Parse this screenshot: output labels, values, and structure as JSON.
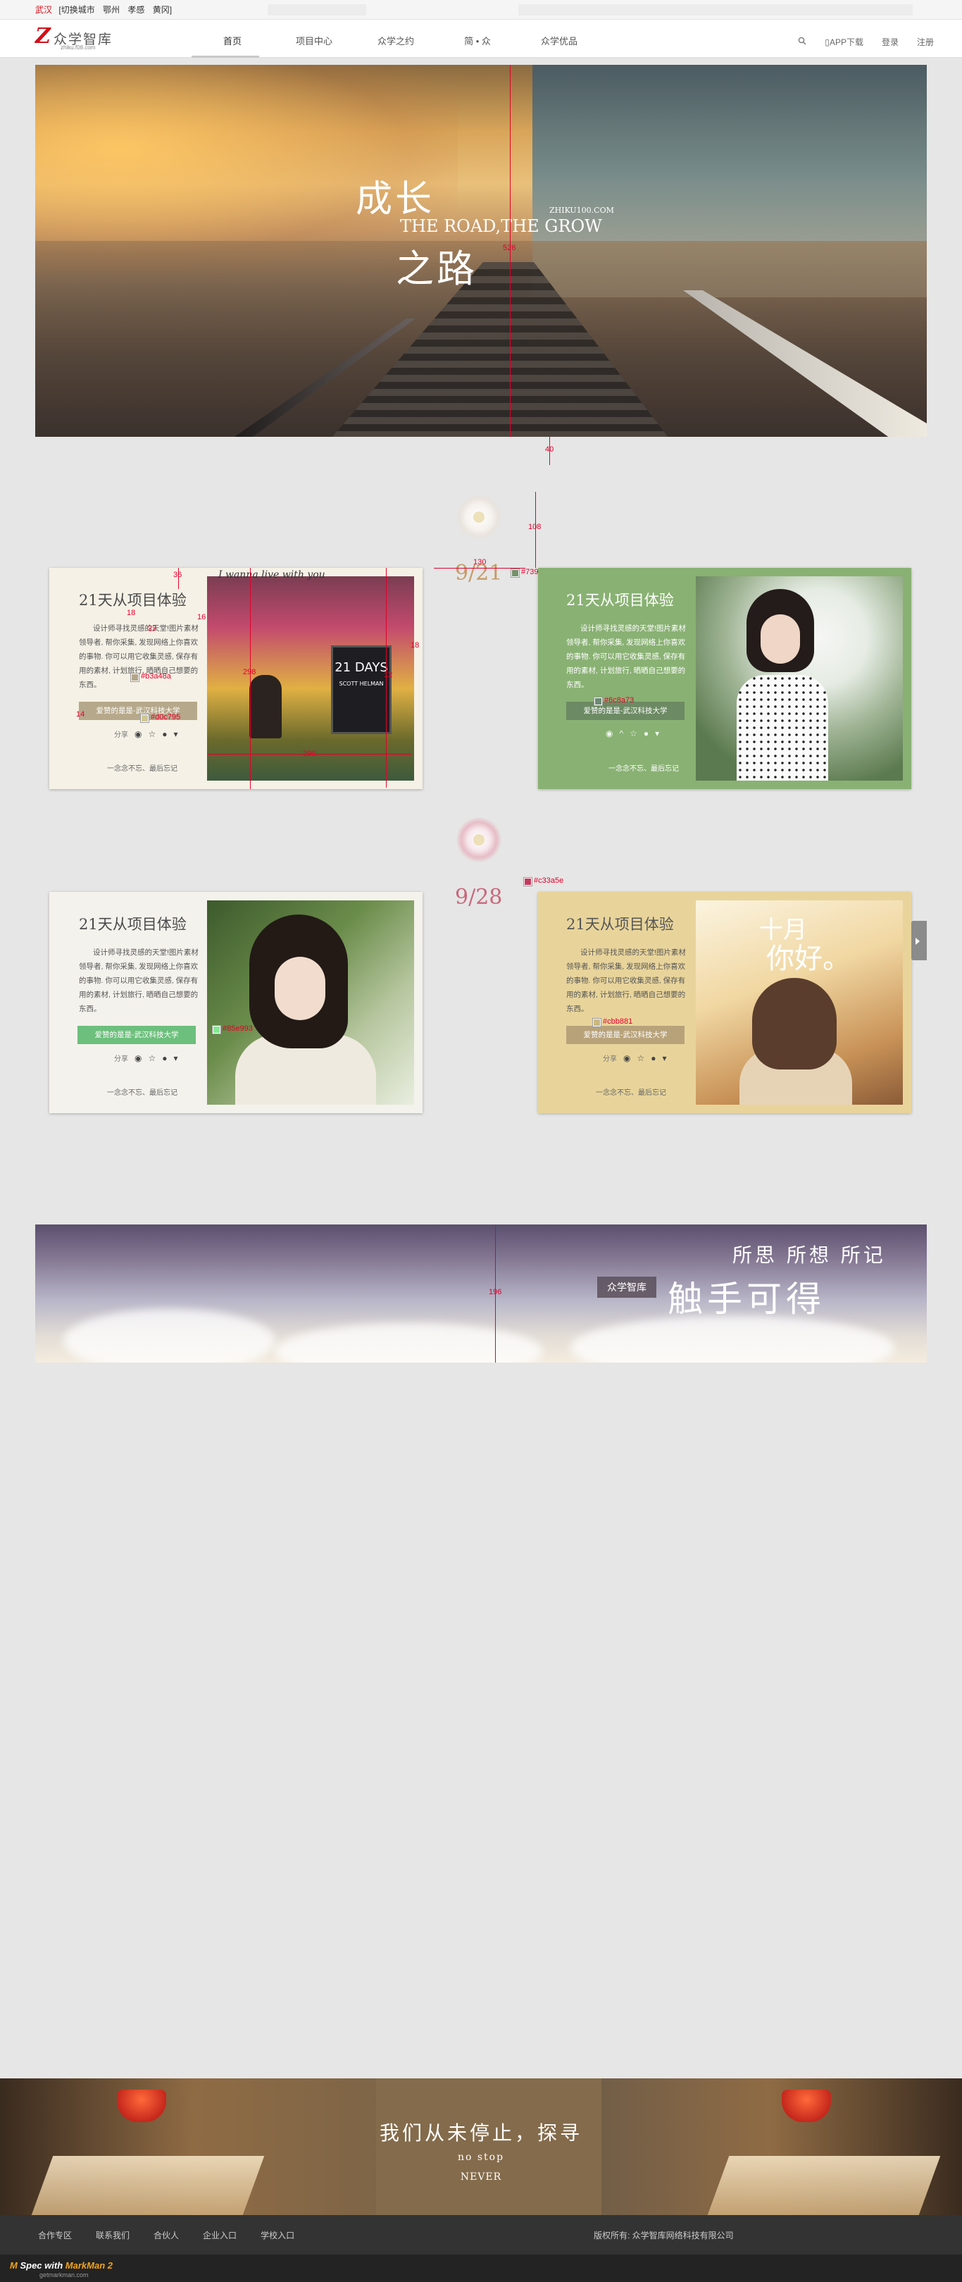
{
  "topbar": {
    "current_city": "武汉",
    "switch_label": "[切换城市",
    "cities": [
      "鄂州",
      "孝感",
      "黄冈]"
    ]
  },
  "header": {
    "logo_mark": "Z",
    "logo_name": "众学智库",
    "logo_url": "zhiku.f08.com",
    "nav": [
      "首页",
      "项目中心",
      "众学之约",
      "简 • 众",
      "众学优品"
    ],
    "app_download": "APP下载",
    "login": "登录",
    "register": "注册"
  },
  "hero": {
    "line1": "成长",
    "line2": "THE ROAD,THE GROW",
    "line3": "之路",
    "site": "ZHIKU100.COM"
  },
  "spec": {
    "hero_height": "526",
    "gap_below_hero": "40",
    "flower_gap": "108",
    "date_width": "130",
    "color_green": "#73916b",
    "color_pink": "#c33a5e",
    "dim_36": "36",
    "dim_18": "18",
    "dim_22": "22",
    "dim_16": "16",
    "dim_14": "14",
    "dim_298": "298",
    "dim_290": "290",
    "dim_18b": "18",
    "dim_12": "12",
    "sky_height": "196",
    "card1_color1": "#b3a48a",
    "card1_color2": "#d0c795",
    "card2_color": "#6c8a73",
    "card3_color": "#85e993",
    "card4_color": "#cbb881"
  },
  "sections": [
    {
      "date": "9/21"
    },
    {
      "date": "9/28"
    }
  ],
  "cards": [
    {
      "title": "21天从项目体验",
      "desc": "设计师寻找灵感的天堂!图片素材领导者, 帮你采集, 发现网络上你喜欢的事物. 你可以用它收集灵感, 保存有用的素材, 计划旅行, 晒晒自己想要的东西。",
      "tag": "爱赞的是是-武汉科技大学",
      "share_label": "分享",
      "footer": "一念念不忘、最后忘记",
      "book_title": "21 DAYS",
      "book_author": "SCOTT HELMAN",
      "handwriting": "I wanna live with you"
    },
    {
      "title": "21天从项目体验",
      "desc": "设计师寻找灵感的天堂!图片素材领导者, 帮你采集, 发现网络上你喜欢的事物. 你可以用它收集灵感, 保存有用的素材, 计划旅行, 晒晒自己想要的东西。",
      "tag": "爱赞的是是-武汉科技大学",
      "share_label": "分享",
      "footer": "一念念不忘、最后忘记"
    },
    {
      "title": "21天从项目体验",
      "desc": "设计师寻找灵感的天堂!图片素材领导者, 帮你采集, 发现网络上你喜欢的事物. 你可以用它收集灵感, 保存有用的素材, 计划旅行, 晒晒自己想要的东西。",
      "tag": "爱赞的是是-武汉科技大学",
      "share_label": "分享",
      "footer": "一念念不忘、最后忘记"
    },
    {
      "title": "21天从项目体验",
      "desc": "设计师寻找灵感的天堂!图片素材领导者, 帮你采集, 发现网络上你喜欢的事物. 你可以用它收集灵感, 保存有用的素材, 计划旅行, 晒晒自己想要的东西。",
      "tag": "爱赞的是是-武汉科技大学",
      "share_label": "分享",
      "footer": "一念念不忘、最后忘记",
      "photo_text1": "十月",
      "photo_text2": "你好。"
    }
  ],
  "sky_banner": {
    "line1": "所思  所想  所记",
    "tag": "众学智库",
    "line2": "触手可得"
  },
  "bottom_banner": {
    "line1": "我们从未停止，探寻",
    "line2": "no stop",
    "line3": "NEVER"
  },
  "footer": {
    "links": [
      "合作专区",
      "联系我们",
      "合伙人",
      "企业入口",
      "学校入口"
    ],
    "copyright": "版权所有: 众学智库网络科技有限公司"
  },
  "specbar": {
    "brand": "Spec with",
    "brand_name": "MarkMan 2",
    "url": "getmarkman.com"
  },
  "colors": {
    "brand_red": "#d0101a",
    "card_green": "#89b173",
    "card_yellow": "#e8d49b",
    "tag_green": "#6cbf7c",
    "tag_tan": "#b6a88a"
  }
}
